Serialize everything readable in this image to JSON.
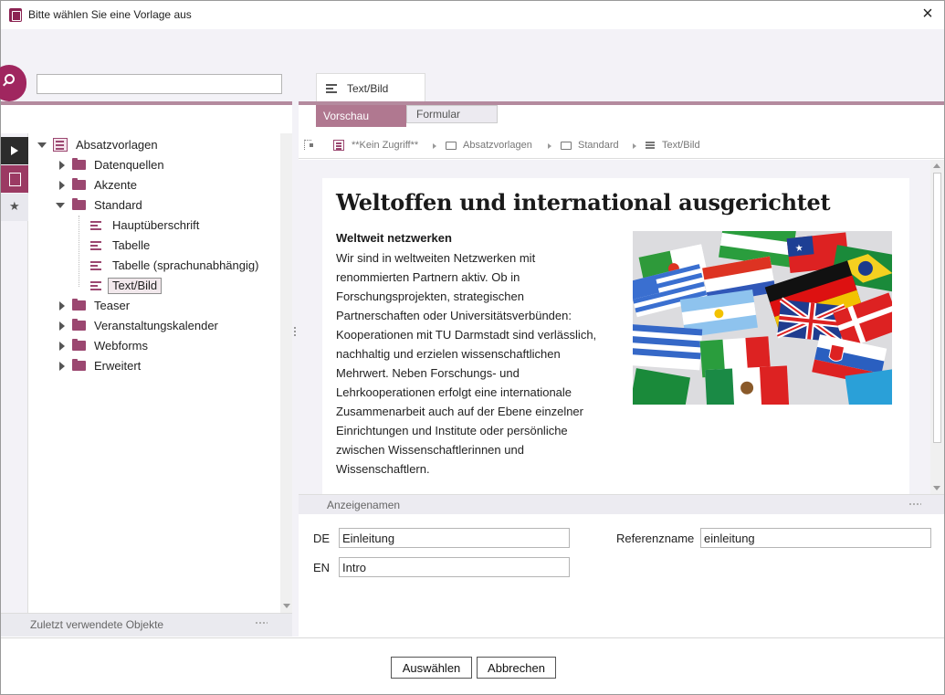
{
  "window": {
    "title": "Bitte wählen Sie eine Vorlage aus",
    "close_icon": "close-icon"
  },
  "search": {
    "value": "",
    "placeholder": ""
  },
  "tree": {
    "root": "Absatzvorlagen",
    "items": [
      {
        "label": "Datenquellen",
        "type": "folder",
        "expanded": false
      },
      {
        "label": "Akzente",
        "type": "folder",
        "expanded": false
      },
      {
        "label": "Standard",
        "type": "folder",
        "expanded": true,
        "children": [
          {
            "label": "Hauptüberschrift",
            "type": "template"
          },
          {
            "label": "Tabelle",
            "type": "template"
          },
          {
            "label": "Tabelle (sprachunabhängig)",
            "type": "template"
          },
          {
            "label": "Text/Bild",
            "type": "template",
            "selected": true
          }
        ]
      },
      {
        "label": "Teaser",
        "type": "folder",
        "expanded": false
      },
      {
        "label": "Veranstaltungskalender",
        "type": "folder",
        "expanded": false
      },
      {
        "label": "Webforms",
        "type": "folder",
        "expanded": false
      },
      {
        "label": "Erweitert",
        "type": "folder",
        "expanded": false
      }
    ]
  },
  "recent": {
    "label": "Zuletzt verwendete Objekte"
  },
  "editor_tab": {
    "label": "Text/Bild"
  },
  "view_tabs": {
    "preview": "Vorschau",
    "form": "Formular"
  },
  "breadcrumb": [
    "**Kein Zugriff**",
    "Absatzvorlagen",
    "Standard",
    "Text/Bild"
  ],
  "preview": {
    "title": "Weltoffen und international ausgerichtet",
    "subtitle": "Weltweit netzwerken",
    "body": "Wir sind in weltweiten Netzwerken mit renommierten Partnern aktiv. Ob in Forschungsprojekten, strategischen Partnerschaften oder Universitätsverbünden: Kooperationen mit TU Darmstadt sind verlässlich, nachhaltig und erzielen wissenschaftlichen Mehrwert. Neben Forschungs- und Lehrkooperationen erfolgt eine internationale Zusammenarbeit auch auf der Ebene einzelner Einrichtungen und Institute oder persönliche zwischen Wissenschaftlerinnen und Wissenschaftlern."
  },
  "display_names": {
    "section_label": "Anzeigenamen",
    "de_label": "DE",
    "de_value": "Einleitung",
    "en_label": "EN",
    "en_value": "Intro",
    "ref_label": "Referenzname",
    "ref_value": "einleitung"
  },
  "buttons": {
    "select": "Auswählen",
    "cancel": "Abbrechen"
  },
  "colors": {
    "accent": "#9b3a63",
    "accent_light": "#b48a9e",
    "panel_bg": "#f3f2f7"
  }
}
